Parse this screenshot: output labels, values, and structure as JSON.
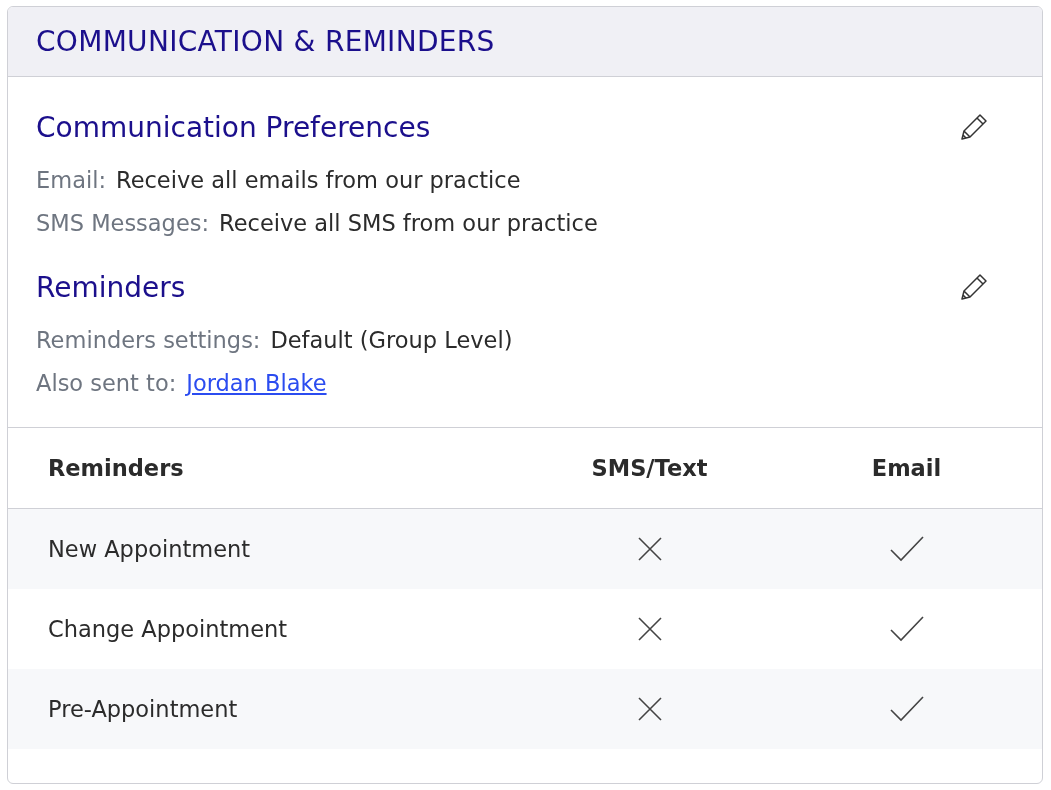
{
  "panel": {
    "title": "COMMUNICATION & REMINDERS"
  },
  "sections": [
    {
      "title": "Communication Preferences",
      "fields": [
        {
          "label": "Email:",
          "value": "Receive all emails from our practice"
        },
        {
          "label": "SMS Messages:",
          "value": "Receive all SMS from our practice"
        }
      ]
    },
    {
      "title": "Reminders",
      "fields": [
        {
          "label": "Reminders settings:",
          "value": "Default (Group Level)"
        },
        {
          "label": "Also sent to:",
          "value": "Jordan Blake",
          "kind": "link"
        }
      ]
    }
  ],
  "table": {
    "columns": [
      "Reminders",
      "SMS/Text",
      "Email"
    ],
    "rows": [
      {
        "name": "New Appointment",
        "sms": false,
        "email": true
      },
      {
        "name": "Change Appointment",
        "sms": false,
        "email": true
      },
      {
        "name": "Pre-Appointment",
        "sms": false,
        "email": true
      }
    ]
  }
}
